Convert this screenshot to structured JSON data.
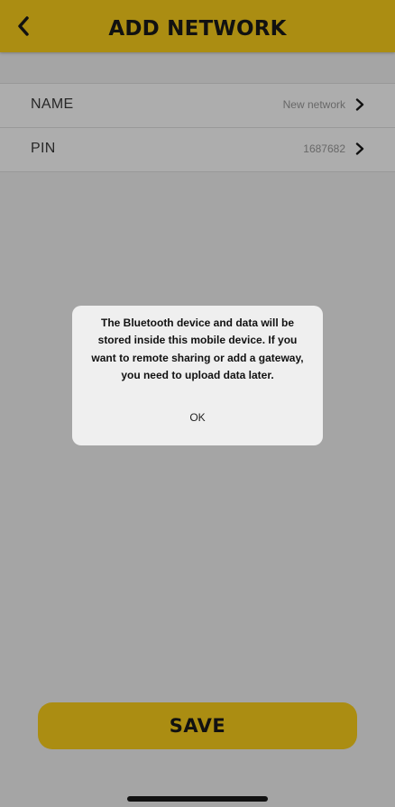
{
  "header": {
    "title": "ADD NETWORK",
    "back_icon": "chevron-left-icon"
  },
  "rows": [
    {
      "label": "NAME",
      "value": "New network",
      "icon": "chevron-right-icon"
    },
    {
      "label": "PIN",
      "value": "1687682",
      "icon": "chevron-right-icon"
    }
  ],
  "save_label": "SAVE",
  "dialog": {
    "message": "The Bluetooth device and data will be stored inside this mobile device. If you want to remote sharing or add a gateway, you need to upload data later.",
    "ok_label": "OK"
  },
  "colors": {
    "accent": "#fdd01b",
    "background": "#f3f3f3",
    "text": "#1a1a1a"
  }
}
